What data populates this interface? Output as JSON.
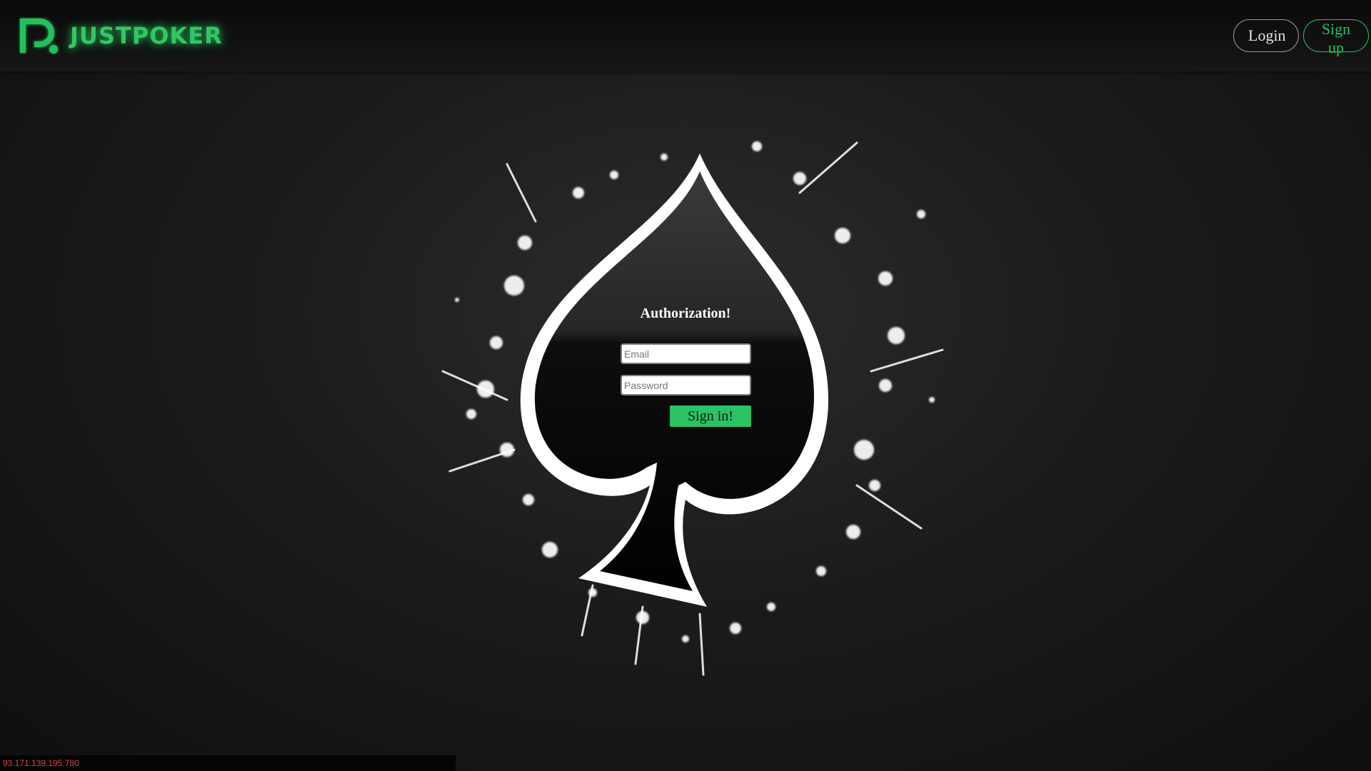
{
  "brand": {
    "name": "JUSTPOKER",
    "accent_color": "#2fc864",
    "logo_icon": "justpoker-p-logo-icon"
  },
  "header": {
    "login_label": "Login",
    "signup_label": "Sign up"
  },
  "auth_form": {
    "title": "Authorization!",
    "email_placeholder": "Email",
    "password_placeholder": "Password",
    "submit_label": "Sign in!",
    "submit_color": "#2bc265"
  },
  "background": {
    "emblem": "spade-splash-icon"
  },
  "status_bar": {
    "text": "93.171.139.195:780"
  }
}
